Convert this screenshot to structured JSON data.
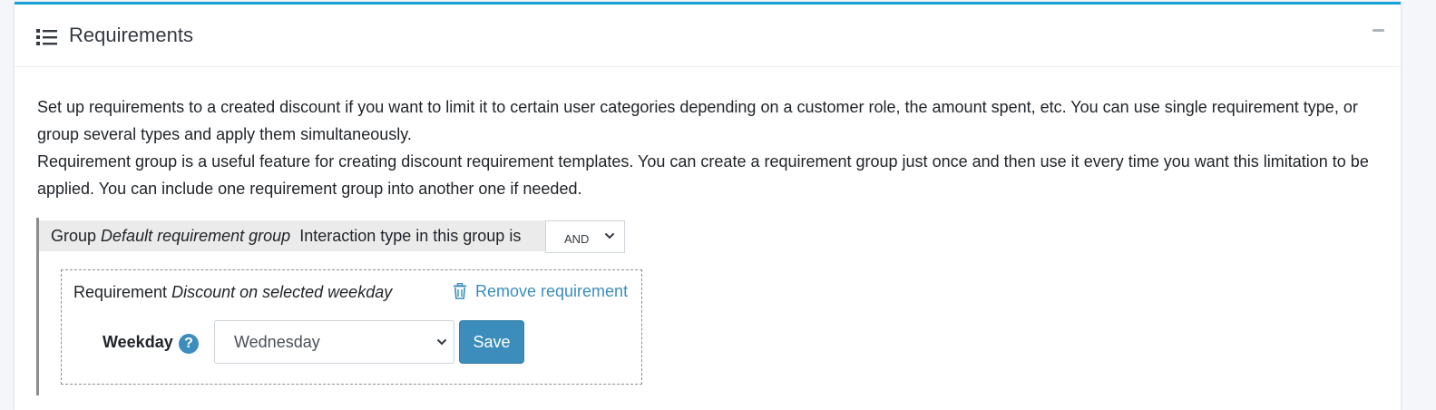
{
  "card": {
    "title": "Requirements",
    "icon": "list-icon",
    "collapse_icon": "minus-icon"
  },
  "description": {
    "paragraph1": "Set up requirements to a created discount if you want to limit it to certain user categories depending on a customer role, the amount spent, etc. You can use single requirement type, or group several types and apply them simultaneously.",
    "paragraph2": "Requirement group is a useful feature for creating discount requirement templates. You can create a requirement group just once and then use it every time you want this limitation to be applied. You can include one requirement group into another one if needed."
  },
  "group": {
    "prefix": "Group",
    "name": "Default requirement group",
    "interaction_label": "Interaction type in this group is",
    "interaction_value": "AND"
  },
  "requirement": {
    "prefix": "Requirement",
    "name": "Discount on selected weekday",
    "remove_label": "Remove requirement",
    "remove_icon": "trash-icon",
    "weekday_label": "Weekday",
    "help_icon": "question-circle-icon",
    "help_glyph": "?",
    "weekday_value": "Wednesday",
    "save_label": "Save"
  },
  "colors": {
    "accent_top_border": "#17a2d6",
    "primary": "#3c8dbc",
    "group_header_bg": "#ebebeb"
  }
}
